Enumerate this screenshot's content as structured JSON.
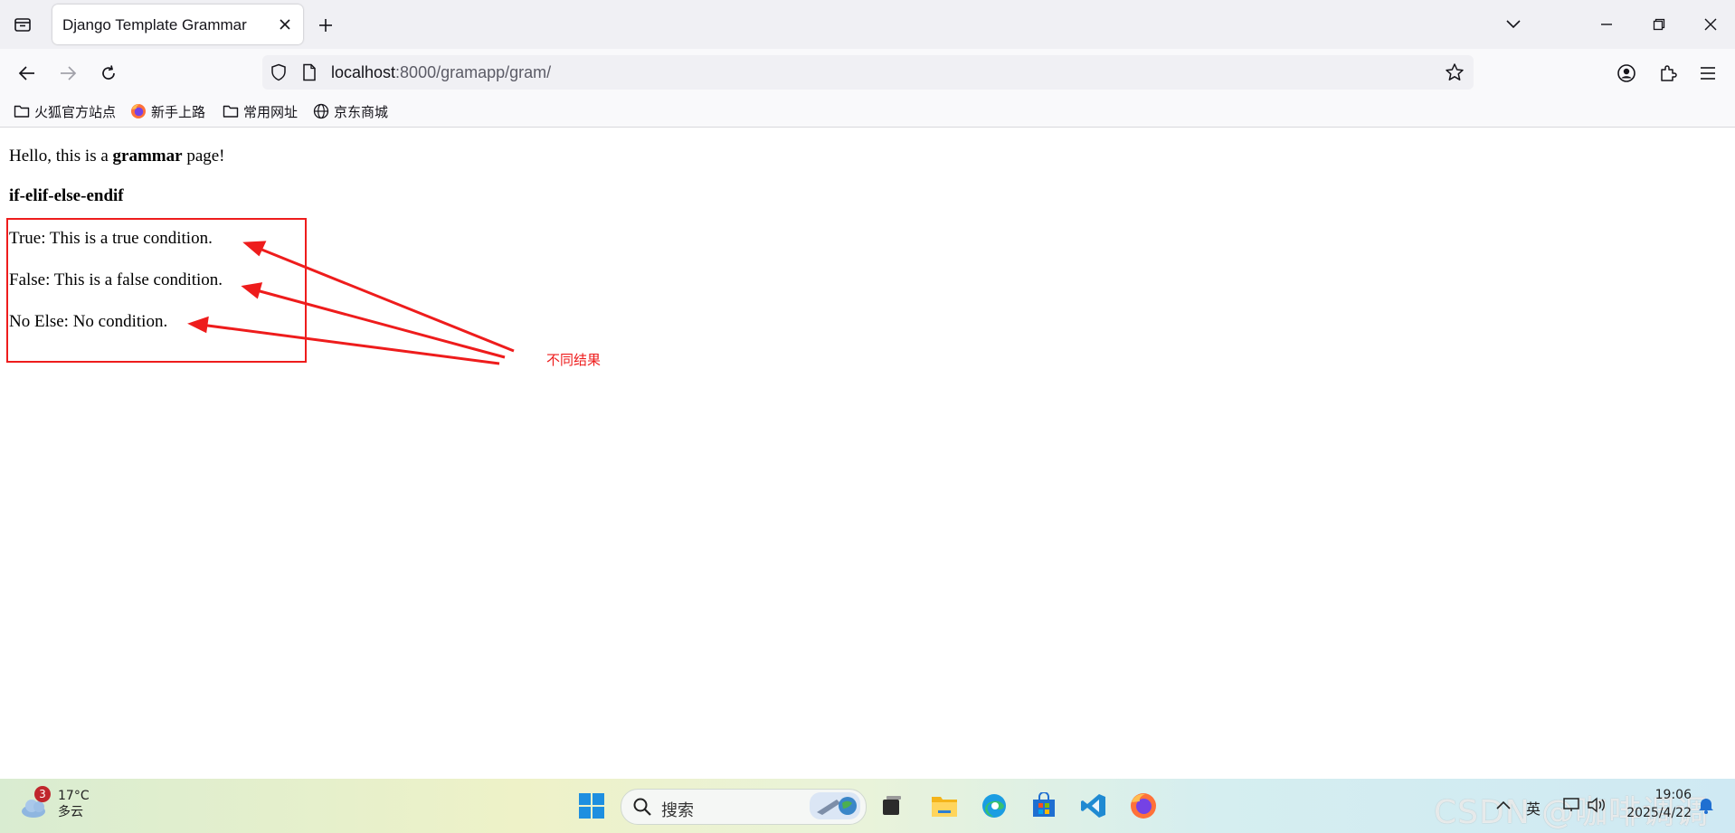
{
  "browser": {
    "tab_title": "Django Template Grammar",
    "url_host": "localhost",
    "url_rest": ":8000/gramapp/gram/",
    "bookmarks": [
      {
        "label": "火狐官方站点",
        "icon": "folder-icon"
      },
      {
        "label": "新手上路",
        "icon": "firefox-icon"
      },
      {
        "label": "常用网址",
        "icon": "folder-icon"
      },
      {
        "label": "京东商城",
        "icon": "globe-icon"
      }
    ]
  },
  "page": {
    "hello_prefix": "Hello, this is a ",
    "hello_bold": "grammar",
    "hello_suffix": " page!",
    "heading": "if-elif-else-endif",
    "lines": [
      "True: This is a true condition.",
      "False: This is a false condition.",
      "No Else: No condition."
    ]
  },
  "annotation": {
    "label": "不同结果",
    "color": "#ee1c1c"
  },
  "taskbar": {
    "weather_badge": "3",
    "temperature": "17°C",
    "weather_desc": "多云",
    "search_placeholder": "搜索",
    "ime_label": "英",
    "time": "19:06",
    "date": "2025/4/22",
    "watermark": "CSDN @咖啡调调"
  }
}
